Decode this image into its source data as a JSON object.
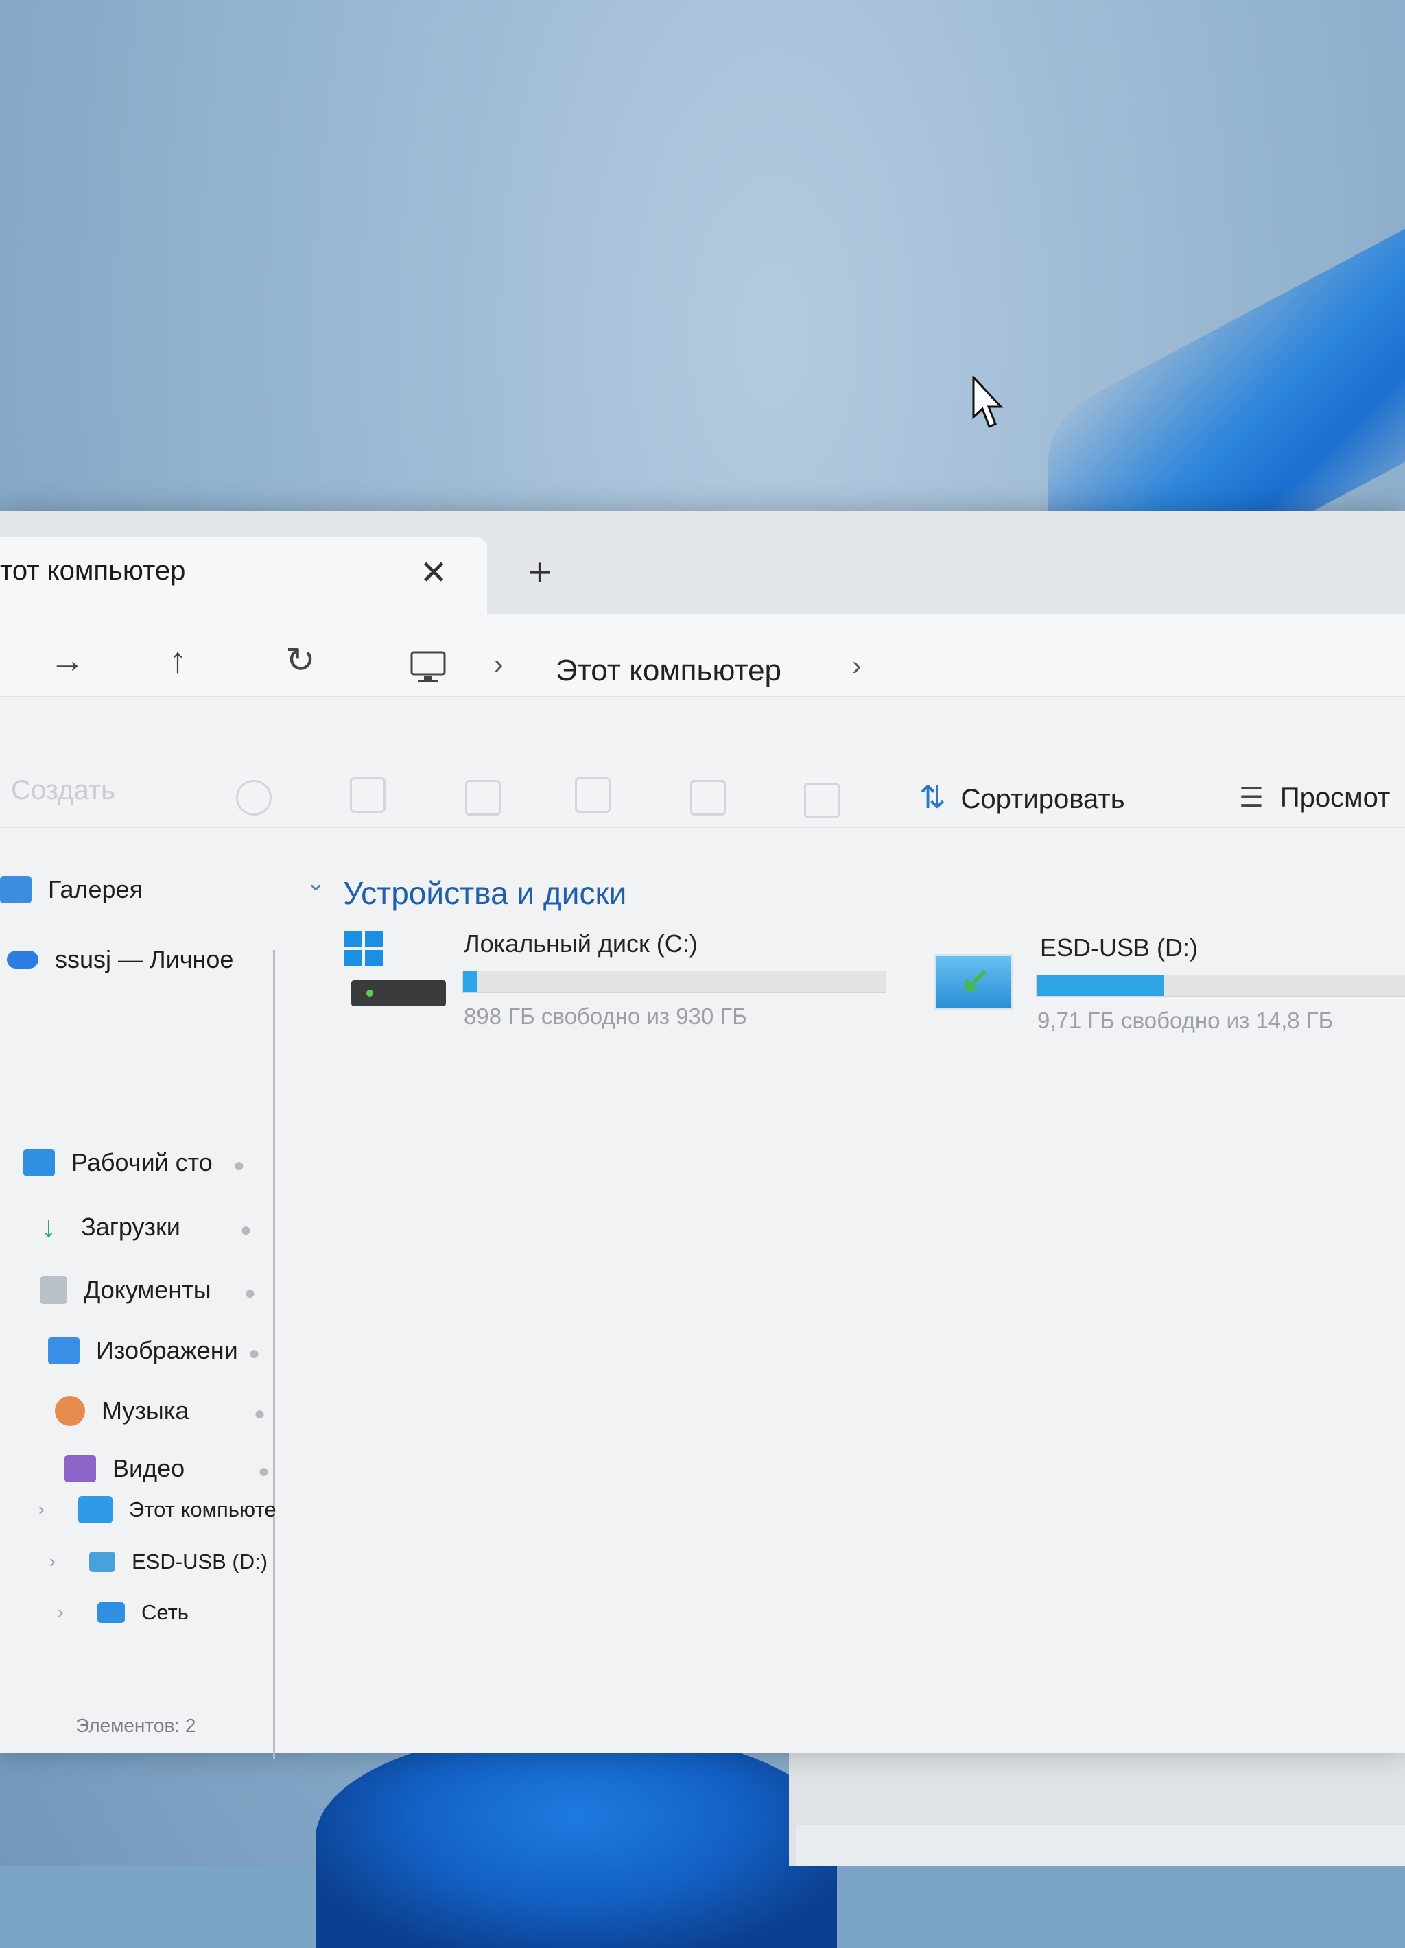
{
  "window": {
    "tab_title": "тот компьютер",
    "tab_close": "✕",
    "new_tab": "+"
  },
  "nav": {
    "forward_icon": "→",
    "up_icon": "↑",
    "refresh_icon": "↻",
    "breadcrumb_sep": "›",
    "breadcrumb_item": "Этот компьютер",
    "breadcrumb_trailing_sep": "›"
  },
  "toolbar": {
    "create_label": "Создать",
    "sort_icon": "⇅",
    "sort_label": "Сортировать",
    "view_icon": "☰",
    "view_label": "Просмот"
  },
  "sidebar": {
    "gallery": "Галерея",
    "onedrive": "ssusj — Личное",
    "quick_access": [
      {
        "label": "Рабочий сто",
        "color": "#2f8fe0"
      },
      {
        "label": "Загрузки",
        "color": "#1fa67a"
      },
      {
        "label": "Документы",
        "color": "#9aa3ad"
      },
      {
        "label": "Изображени",
        "color": "#3a8ee6"
      },
      {
        "label": "Музыка",
        "color": "#e58b4e"
      },
      {
        "label": "Видео",
        "color": "#8d63c8"
      }
    ],
    "pin_icon": "📌",
    "chevron_icon": "›",
    "this_pc": "Этот компьюте",
    "esd_usb": "ESD-USB (D:)",
    "network": "Сеть"
  },
  "content": {
    "section_chevron": "⌄",
    "section_title": "Устройства и диски",
    "drives": [
      {
        "name": "Локальный диск (C:)",
        "free_text": "898 ГБ свободно из 930 ГБ",
        "used_fraction": 0.034
      },
      {
        "name": "ESD-USB (D:)",
        "free_text": "9,71 ГБ свободно из 14,8 ГБ",
        "used_fraction": 0.344
      }
    ]
  },
  "status_bar": {
    "items_count": "Элементов: 2"
  }
}
